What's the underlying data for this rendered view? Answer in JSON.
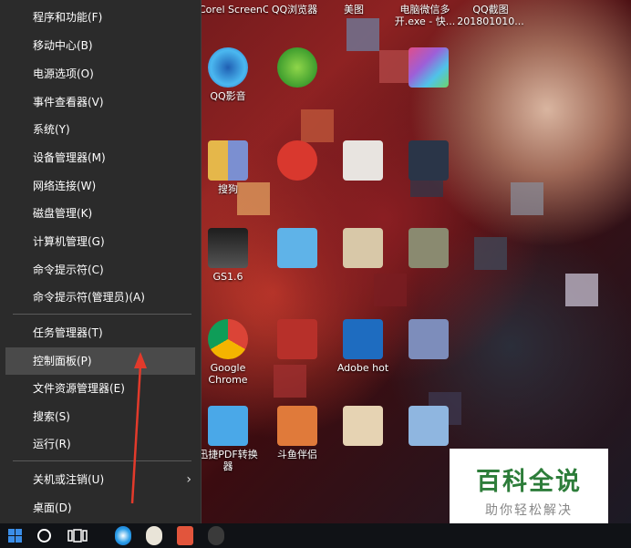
{
  "desktop": {
    "icons_top_row": [
      "Corel ScreenC...",
      "QQ浏览器",
      "美图",
      "电脑微信多开.exe - 快...",
      "QQ截图201801010..."
    ],
    "icons": {
      "qq_player": "QQ影音",
      "sogou": "搜狗",
      "gs": "GS1.6",
      "chrome": "Google Chrome",
      "adobe": "Adobe hot",
      "xunjie_pdf": "迅捷PDF转换器",
      "douyu": "斗鱼伴侣"
    }
  },
  "winx_menu": {
    "items": [
      {
        "label": "程序和功能(F)"
      },
      {
        "label": "移动中心(B)"
      },
      {
        "label": "电源选项(O)"
      },
      {
        "label": "事件查看器(V)"
      },
      {
        "label": "系统(Y)"
      },
      {
        "label": "设备管理器(M)"
      },
      {
        "label": "网络连接(W)"
      },
      {
        "label": "磁盘管理(K)"
      },
      {
        "label": "计算机管理(G)"
      },
      {
        "label": "命令提示符(C)"
      },
      {
        "label": "命令提示符(管理员)(A)"
      },
      {
        "label": "任务管理器(T)"
      },
      {
        "label": "控制面板(P)"
      },
      {
        "label": "文件资源管理器(E)"
      },
      {
        "label": "搜索(S)"
      },
      {
        "label": "运行(R)"
      },
      {
        "label": "关机或注销(U)"
      },
      {
        "label": "桌面(D)"
      }
    ],
    "highlighted": "控制面板(P)",
    "submenu_glyph": "›"
  },
  "watermark": {
    "title": "百科全说",
    "subtitle": "助你轻松解决"
  },
  "colors": {
    "menu_bg": "#2b2b2b",
    "menu_highlight": "#4a4a4a",
    "arrow": "#e23a2b",
    "taskbar": "#101216",
    "watermark_green": "#2d7d3a"
  }
}
